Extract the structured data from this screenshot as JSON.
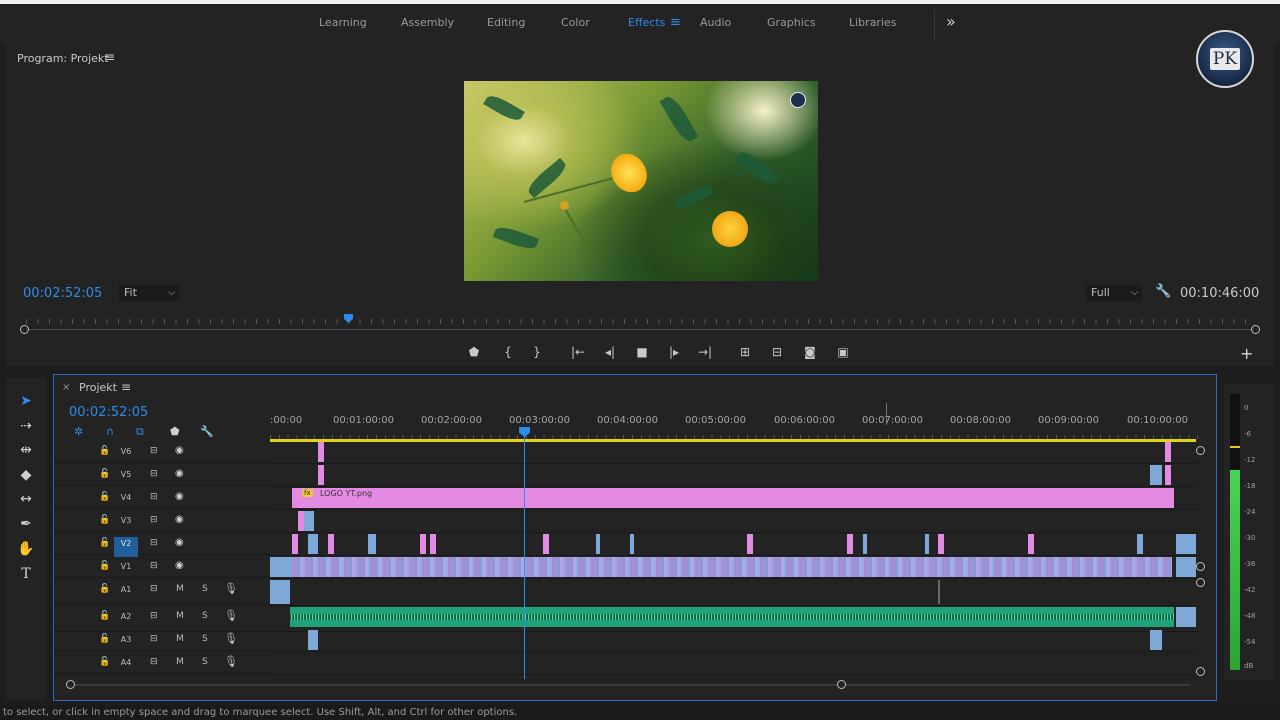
{
  "workspaces": {
    "tabs": [
      {
        "label": "Learning"
      },
      {
        "label": "Assembly"
      },
      {
        "label": "Editing"
      },
      {
        "label": "Color"
      },
      {
        "label": "Effects"
      },
      {
        "label": "Audio"
      },
      {
        "label": "Graphics"
      },
      {
        "label": "Libraries"
      }
    ],
    "active": "Effects",
    "accent_color": "#2d8ceb"
  },
  "logo": {
    "text": "PK"
  },
  "program_monitor": {
    "title": "Program: Projekt",
    "current_timecode": "00:02:52:05",
    "zoom_select": "Fit",
    "resolution_select": "Full",
    "duration_timecode": "00:10:46:00"
  },
  "timeline": {
    "title": "Projekt",
    "current_timecode": "00:02:52:05",
    "ruler_labels": [
      ":00:00",
      "00:01:00:00",
      "00:02:00:00",
      "00:03:00:00",
      "00:04:00:00",
      "00:05:00:00",
      "00:06:00:00",
      "00:07:00:00",
      "00:08:00:00",
      "00:09:00:00",
      "00:10:00:00"
    ],
    "video_tracks": [
      "V6",
      "V5",
      "V4",
      "V3",
      "V2",
      "V1"
    ],
    "audio_tracks": [
      "A1",
      "A2",
      "A3",
      "A4"
    ],
    "selected_track": "V2",
    "audio_mute_label": "M",
    "audio_solo_label": "S",
    "logo_clip_name": "LOGO YT.png",
    "fx_badge": "fx",
    "clip_colors": {
      "graphic": "#e38be3",
      "video": "#7ea8d8",
      "audio": "#2bb386"
    }
  },
  "meter": {
    "scale": [
      "0",
      "-6",
      "-12",
      "-18",
      "-24",
      "-30",
      "-36",
      "-42",
      "-48",
      "-54",
      "dB"
    ]
  },
  "status_bar": {
    "text": "to select, or click in empty space and drag to marquee select. Use Shift, Alt, and Ctrl for other options."
  }
}
